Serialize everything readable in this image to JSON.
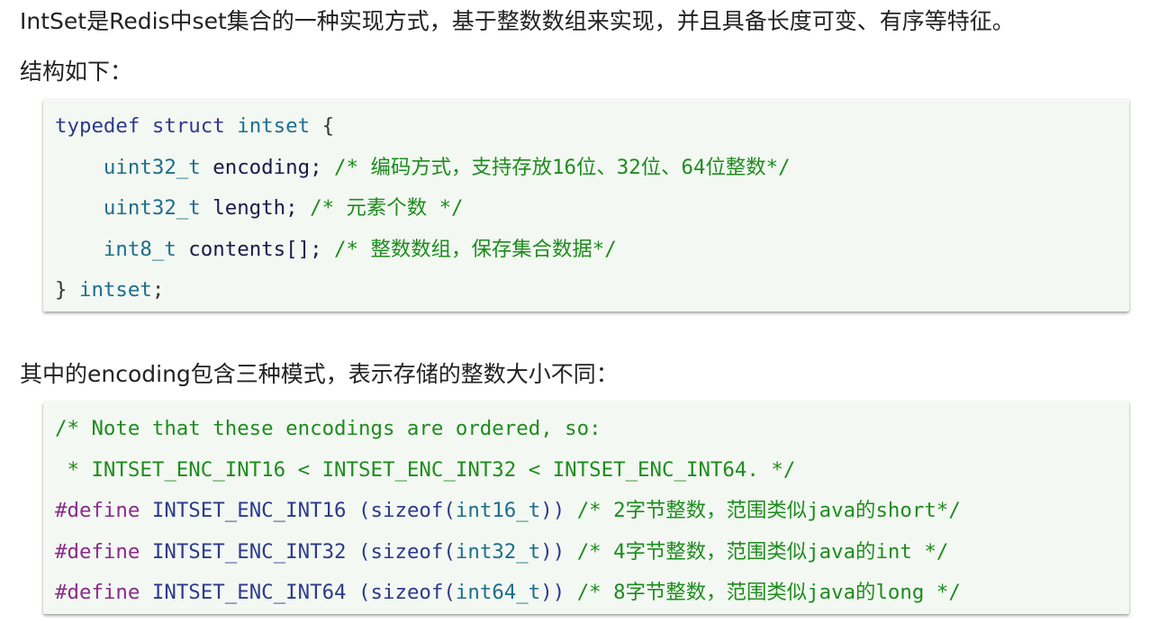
{
  "intro": {
    "line1": "IntSet是Redis中set集合的一种实现方式，基于整数数组来实现，并且具备长度可变、有序等特征。",
    "line2": "结构如下："
  },
  "code1": {
    "l1": {
      "kw": "typedef struct",
      "sp": " ",
      "ty": "intset",
      "rest": " {"
    },
    "l2": {
      "indent": "    ",
      "ty": "uint32_t",
      "id": " encoding;",
      "cm": " /* 编码方式，支持存放16位、32位、64位整数*/"
    },
    "l3": {
      "indent": "    ",
      "ty": "uint32_t",
      "id": " length;",
      "cm": " /* 元素个数 */"
    },
    "l4": {
      "indent": "    ",
      "ty": "int8_t",
      "id": " contents[];",
      "cm": " /* 整数数组，保存集合数据*/"
    },
    "l5": {
      "pl": "} ",
      "ty": "intset",
      "rest": ";"
    }
  },
  "mid": {
    "line": "其中的encoding包含三种模式，表示存储的整数大小不同："
  },
  "code2": {
    "l1": {
      "cm": "/* Note that these encodings are ordered, so:"
    },
    "l2": {
      "cm": " * INTSET_ENC_INT16 < INTSET_ENC_INT32 < INTSET_ENC_INT64. */"
    },
    "l3": {
      "pp": "#define",
      "id": " INTSET_ENC_INT16 (sizeof(",
      "ty": "int16_t",
      "id2": "))",
      "cm": " /* 2字节整数，范围类似java的short*/"
    },
    "l4": {
      "pp": "#define",
      "id": " INTSET_ENC_INT32 (sizeof(",
      "ty": "int32_t",
      "id2": "))",
      "cm": " /* 4字节整数，范围类似java的int */"
    },
    "l5": {
      "pp": "#define",
      "id": " INTSET_ENC_INT64 (sizeof(",
      "ty": "int64_t",
      "id2": "))",
      "cm": " /* 8字节整数，范围类似java的long */"
    }
  },
  "colors": {
    "keyword": "#2d3a8c",
    "type": "#1f6e8c",
    "comment": "#1e8c1e",
    "preprocessor": "#8a2a8a",
    "code_bg": "#f3f8f2"
  }
}
